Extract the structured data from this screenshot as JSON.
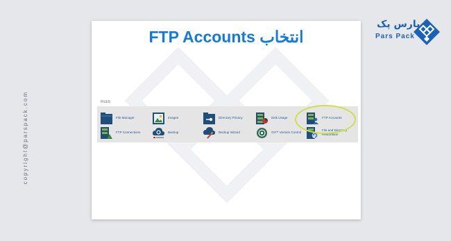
{
  "page": {
    "title": "FTP Accounts انتخاب",
    "copyright": "copyright@parspack.com"
  },
  "logo": {
    "brand_fa": "پارس پک",
    "brand_en": "Pars Pack"
  },
  "files": {
    "section_label": "FILES",
    "items": [
      {
        "label": "File Manager",
        "icon": "file-manager-icon"
      },
      {
        "label": "Images",
        "icon": "images-icon"
      },
      {
        "label": "Directory Privacy",
        "icon": "directory-privacy-icon"
      },
      {
        "label": "Disk Usage",
        "icon": "disk-usage-icon"
      },
      {
        "label": "FTP Accounts",
        "icon": "ftp-accounts-icon"
      },
      {
        "label": "FTP Connections",
        "icon": "ftp-connections-icon"
      },
      {
        "label": "Backup",
        "icon": "backup-icon"
      },
      {
        "label": "Backup Wizard",
        "icon": "backup-wizard-icon"
      },
      {
        "label": "Git™ Version Control",
        "icon": "git-icon"
      },
      {
        "label": "File and Directory Restoration",
        "icon": "restoration-icon"
      }
    ],
    "highlighted_item": "FTP Accounts"
  },
  "colors": {
    "title": "#1479dc",
    "brand": "#1a62b8",
    "link": "#225b99",
    "highlight": "#cfe04a",
    "panel": "#e5e5e5"
  }
}
